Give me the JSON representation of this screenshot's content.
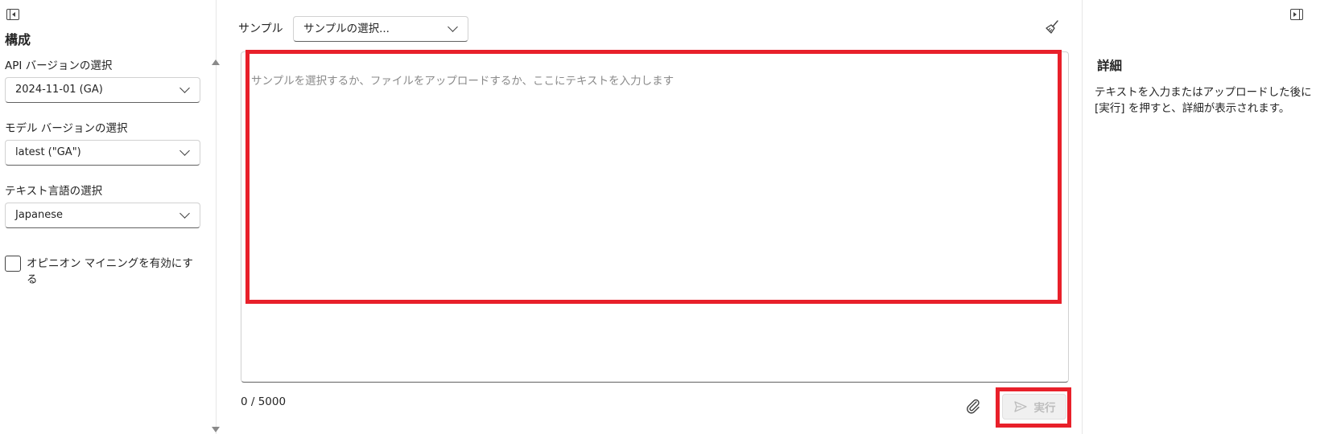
{
  "left_panel": {
    "section_title": "構成",
    "api_version": {
      "label": "API バージョンの選択",
      "value": "2024-11-01 (GA)"
    },
    "model_version": {
      "label": "モデル バージョンの選択",
      "value": "latest (\"GA\")"
    },
    "text_language": {
      "label": "テキスト言語の選択",
      "value": "Japanese"
    },
    "opinion_mining": {
      "label": "オピニオン マイニングを有効にする",
      "checked": false
    }
  },
  "center": {
    "sample_label": "サンプル",
    "sample_dropdown_value": "サンプルの選択...",
    "text_placeholder": "サンプルを選択するか、ファイルをアップロードするか、ここにテキストを入力します",
    "char_count": "0 / 5000",
    "run_label": "実行"
  },
  "right_panel": {
    "details_title": "詳細",
    "details_text": "テキストを入力またはアップロードした後に [実行] を押すと、詳細が表示されます。"
  },
  "colors": {
    "highlight": "#e8202a",
    "disabled_button_bg": "#f0f0f0",
    "disabled_text": "#bdbdbd"
  },
  "icons": {
    "collapse_left": "panel-collapse-left-icon",
    "collapse_right": "panel-collapse-right-icon",
    "clear": "broom-icon",
    "attach": "paperclip-icon",
    "send": "send-icon",
    "dropdown": "chevron-down-icon"
  }
}
